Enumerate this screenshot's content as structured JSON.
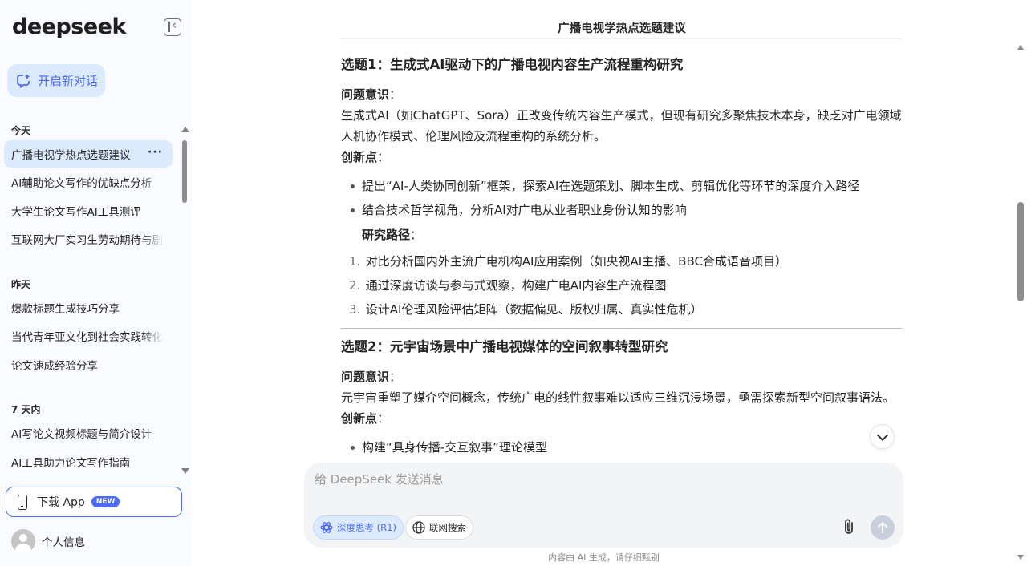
{
  "sidebar": {
    "logo": "deepseek",
    "new_chat_label": "开启新对话",
    "sections": [
      {
        "label": "今天",
        "items": [
          "广播电视学热点选题建议",
          "AI辅助论文写作的优缺点分析",
          "大学生论文写作AI工具测评",
          "互联网大厂实习生劳动期待与剧本"
        ]
      },
      {
        "label": "昨天",
        "items": [
          "爆款标题生成技巧分享",
          "当代青年亚文化到社会实践转化研究",
          "论文速成经验分享"
        ]
      },
      {
        "label": "7 天内",
        "items": [
          "AI写论文视频标题与简介设计",
          "AI工具助力论文写作指南"
        ]
      }
    ],
    "active_more": "···",
    "download_label": "下载 App",
    "download_badge": "NEW",
    "profile_label": "个人信息"
  },
  "chat": {
    "title": "广播电视学热点选题建议",
    "topic1": {
      "heading": "选题1：生成式AI驱动下的广播电视内容生产流程重构研究",
      "problem_label": "问题意识",
      "colon": "：",
      "problem_text": "生成式AI（如ChatGPT、Sora）正改变传统内容生产模式，但现有研究多聚焦技术本身，缺乏对广电领域人机协作模式、伦理风险及流程重构的系统分析。",
      "innovation_label": "创新点",
      "innovations": [
        "提出“AI-人类协同创新”框架，探索AI在选题策划、脚本生成、剪辑优化等环节的深度介入路径",
        "结合技术哲学视角，分析AI对广电从业者职业身份认知的影响"
      ],
      "path_label": "研究路径",
      "paths": [
        {
          "num": "1.",
          "text": "对比分析国内外主流广电机构AI应用案例（如央视AI主播、BBC合成语音项目）"
        },
        {
          "num": "2.",
          "text": "通过深度访谈与参与式观察，构建广电AI内容生产流程图"
        },
        {
          "num": "3.",
          "text": "设计AI伦理风险评估矩阵（数据偏见、版权归属、真实性危机）"
        }
      ]
    },
    "topic2": {
      "heading": "选题2：元宇宙场景中广播电视媒体的空间叙事转型研究",
      "problem_label": "问题意识",
      "problem_text": "元宇宙重塑了媒介空间概念，传统广电的线性叙事难以适应三维沉浸场景，亟需探索新型空间叙事语法。",
      "innovation_label": "创新点",
      "partial_item": "构建“具身传播-交互叙事”理论模型"
    }
  },
  "composer": {
    "placeholder": "给 DeepSeek 发送消息",
    "deep_think_label": "深度思考 (R1)",
    "web_search_label": "联网搜索"
  },
  "footer_note": "内容由 AI 生成，请仔细甄别",
  "colors": {
    "accent": "#4d6bfe",
    "sidebar_bg": "#f9fbff",
    "active_bg": "#dbeafe"
  }
}
